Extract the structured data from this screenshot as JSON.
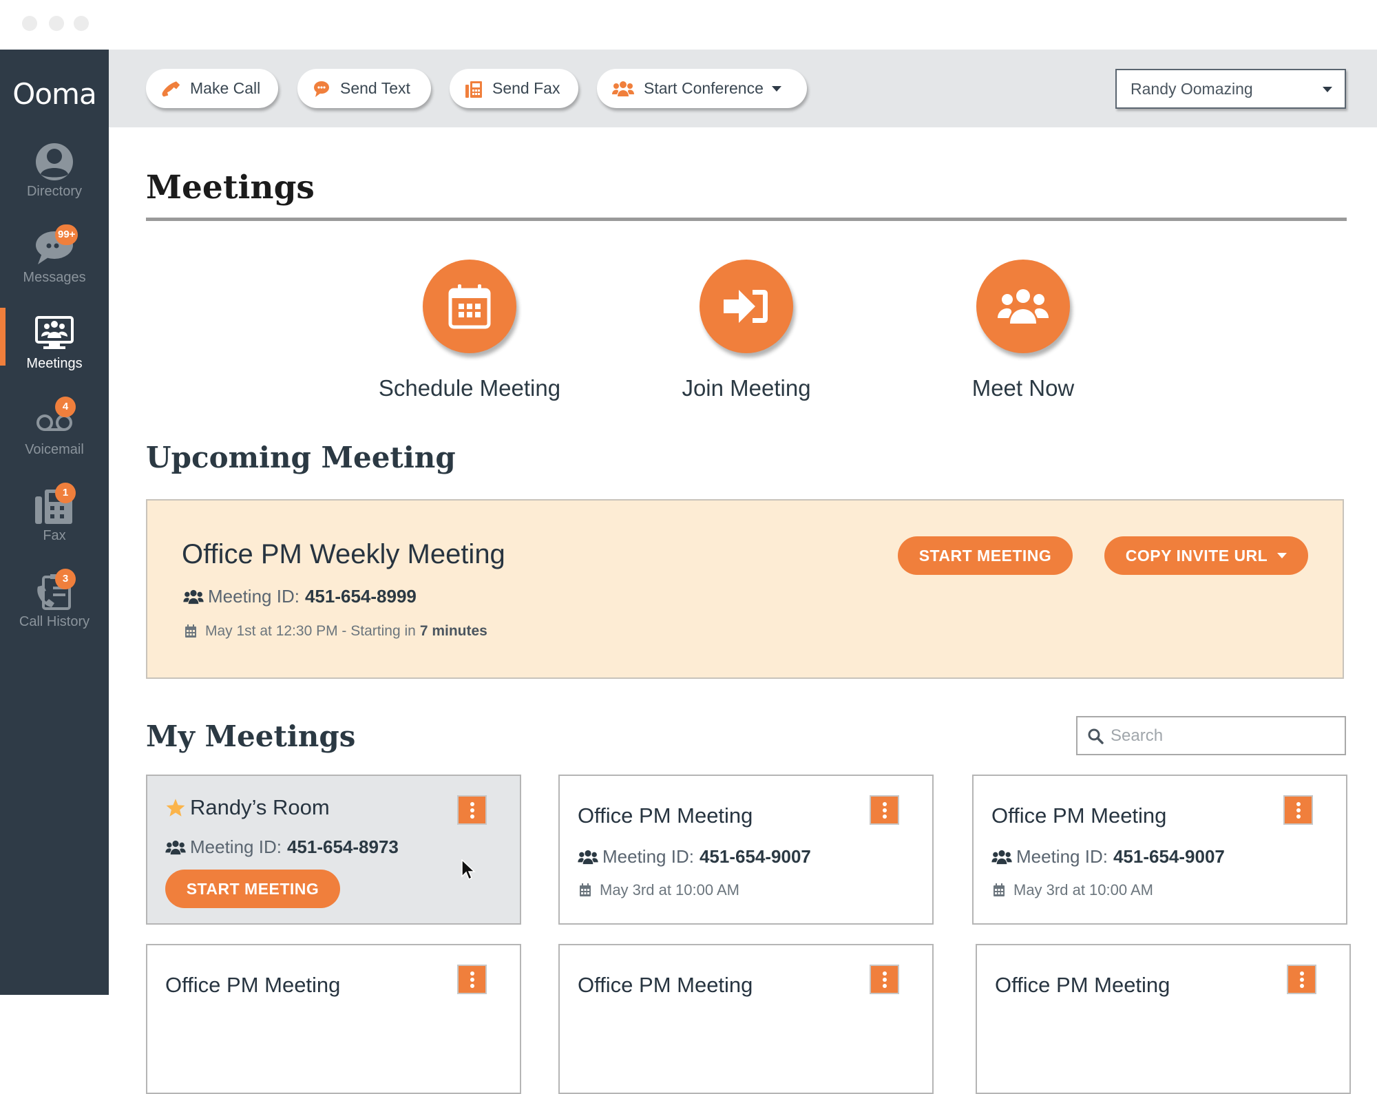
{
  "app": {
    "logo": "Ooma",
    "accent_color": "#f07f3c",
    "sidebar_color": "#2f3b47"
  },
  "sidebar": {
    "items": [
      {
        "label": "Directory",
        "icon": "user-circle-icon",
        "badge": null,
        "active": false
      },
      {
        "label": "Messages",
        "icon": "chat-bubble-icon",
        "badge": "99+",
        "active": false
      },
      {
        "label": "Meetings",
        "icon": "monitor-people-icon",
        "badge": null,
        "active": true
      },
      {
        "label": "Voicemail",
        "icon": "voicemail-icon",
        "badge": "4",
        "active": false
      },
      {
        "label": "Fax",
        "icon": "fax-icon",
        "badge": "1",
        "active": false
      },
      {
        "label": "Call History",
        "icon": "call-history-icon",
        "badge": "3",
        "active": false
      }
    ]
  },
  "toolbar": {
    "make_call": "Make Call",
    "send_text": "Send Text",
    "send_fax": "Send Fax",
    "start_conference": "Start Conference",
    "user_select": "Randy Oomazing"
  },
  "page": {
    "title": "Meetings",
    "actions": [
      {
        "label": "Schedule Meeting",
        "icon": "calendar-icon"
      },
      {
        "label": "Join Meeting",
        "icon": "sign-in-icon"
      },
      {
        "label": "Meet Now",
        "icon": "group-icon"
      }
    ]
  },
  "upcoming": {
    "section_title": "Upcoming Meeting",
    "title": "Office PM Weekly Meeting",
    "meeting_id_label": "Meeting ID:",
    "meeting_id": "451-654-8999",
    "schedule_text": "May 1st at 12:30 PM - Starting in",
    "countdown": "7 minutes",
    "start_button": "START MEETING",
    "copy_button": "COPY INVITE URL"
  },
  "my_meetings": {
    "section_title": "My Meetings",
    "search_placeholder": "Search",
    "cards": [
      {
        "title": "Randy’s Room",
        "starred": true,
        "meeting_id_label": "Meeting ID:",
        "meeting_id": "451-654-8973",
        "button": "START MEETING"
      },
      {
        "title": "Office PM Meeting",
        "meeting_id_label": "Meeting ID:",
        "meeting_id": "451-654-9007",
        "date": "May 3rd at 10:00 AM"
      },
      {
        "title": "Office PM Meeting",
        "meeting_id_label": "Meeting ID:",
        "meeting_id": "451-654-9007",
        "date": "May 3rd at 10:00 AM"
      },
      {
        "title": "Office PM Meeting"
      },
      {
        "title": "Office PM Meeting"
      },
      {
        "title": "Office PM Meeting"
      }
    ]
  }
}
